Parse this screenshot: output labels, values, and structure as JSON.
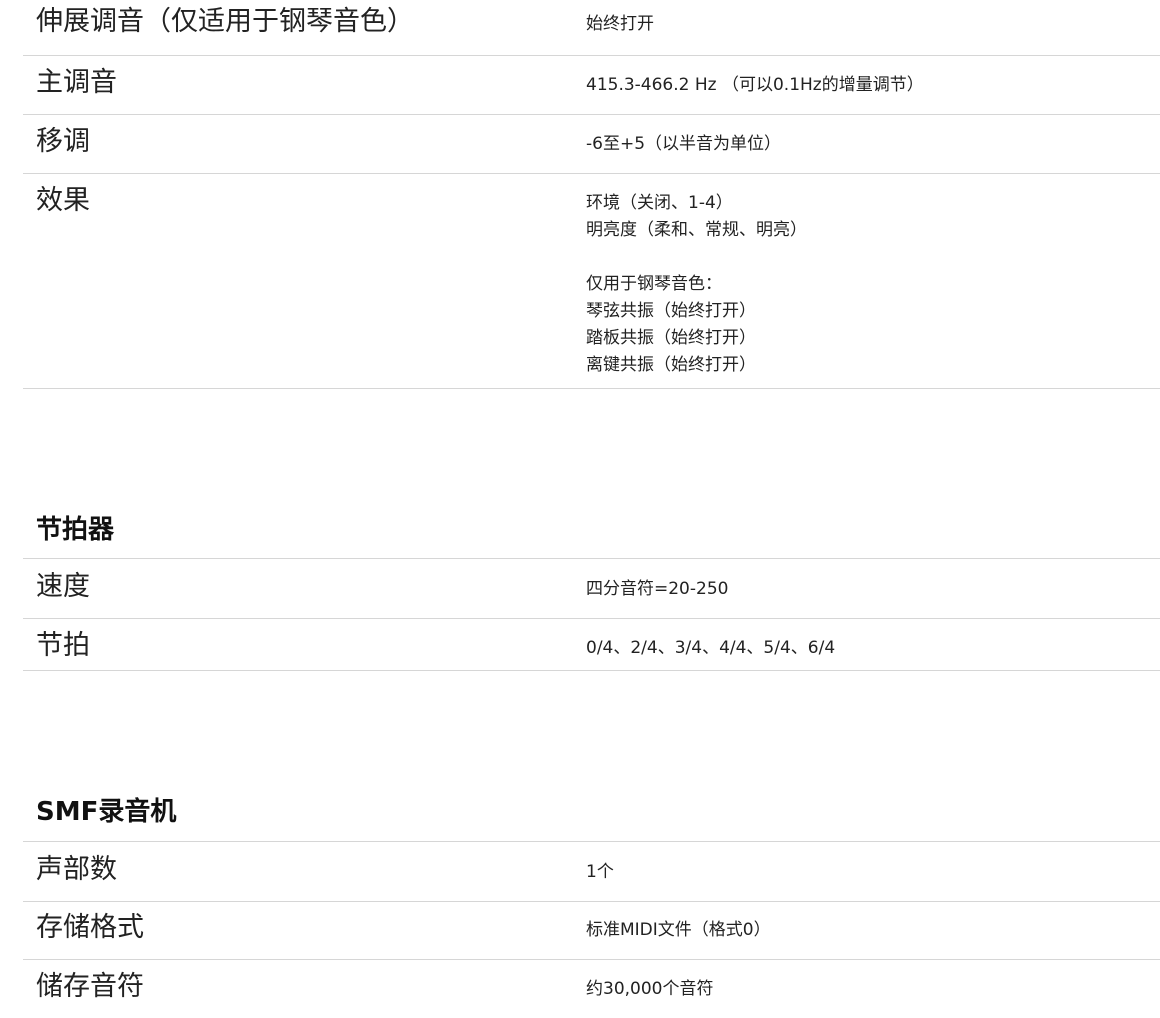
{
  "sound_section": {
    "rows": [
      {
        "label": "伸展调音（仅适用于钢琴音色）",
        "value_lines": [
          "始终打开"
        ]
      },
      {
        "label": "主调音",
        "value_lines": [
          "415.3-466.2 Hz （可以0.1Hz的增量调节）"
        ]
      },
      {
        "label": "移调",
        "value_lines": [
          "-6至+5（以半音为单位）"
        ]
      },
      {
        "label": "效果",
        "value_lines": [
          "环境（关闭、1-4）",
          "明亮度（柔和、常规、明亮）",
          "",
          "仅用于钢琴音色：",
          "琴弦共振（始终打开）",
          "踏板共振（始终打开）",
          "离键共振（始终打开）"
        ]
      }
    ]
  },
  "metronome_section": {
    "heading": "节拍器",
    "rows": [
      {
        "label": "速度",
        "value_lines": [
          "四分音符=20-250"
        ]
      },
      {
        "label": "节拍",
        "value_lines": [
          "0/4、2/4、3/4、4/4、5/4、6/4"
        ]
      }
    ]
  },
  "recorder_section": {
    "heading": "SMF录音机",
    "rows": [
      {
        "label": "声部数",
        "value_lines": [
          "1个"
        ]
      },
      {
        "label": "存储格式",
        "value_lines": [
          "标准MIDI文件（格式0）"
        ]
      },
      {
        "label": "储存音符",
        "value_lines": [
          "约30,000个音符"
        ]
      }
    ]
  }
}
